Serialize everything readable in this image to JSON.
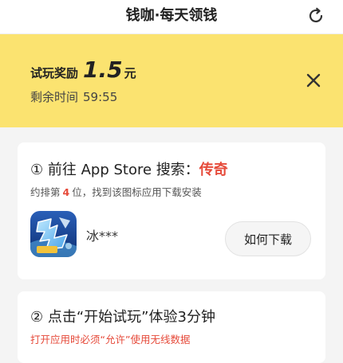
{
  "header": {
    "title": "钱咖·每天领钱",
    "refresh_icon": "refresh-icon"
  },
  "reward": {
    "label": "试玩奖励",
    "amount": "1.5",
    "unit": "元",
    "timer_label": "剩余时间",
    "timer_value": "59:55",
    "close_icon": "close-icon",
    "background_color": "#fbe370"
  },
  "step1": {
    "prefix": "① 前往 App Store 搜索：",
    "keyword": "传奇",
    "hint_before": "约排第",
    "rank": "4",
    "hint_after": "位，找到该图标应用下载安装",
    "app_name": "冰***",
    "download_label": "如何下载"
  },
  "step2": {
    "title": "② 点击“开始试玩”体验3分钟",
    "warning": "打开应用时必须“允许”使用无线数据"
  },
  "colors": {
    "accent_red": "#e64a3a",
    "banner_yellow": "#fbe370"
  }
}
